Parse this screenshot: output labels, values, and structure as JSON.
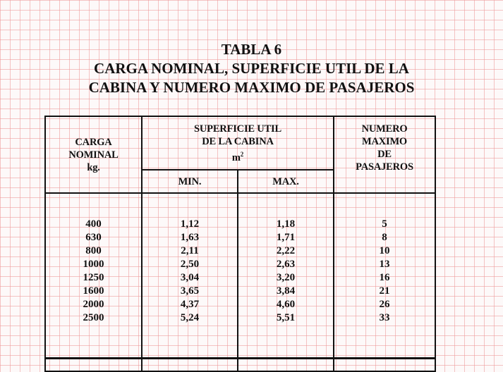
{
  "title": {
    "line1": "TABLA 6",
    "line2": "CARGA NOMINAL,  SUPERFICIE UTIL DE LA",
    "line3": "CABINA Y  NUMERO MAXIMO DE PASAJEROS"
  },
  "headers": {
    "carga_line1": "CARGA",
    "carga_line2": "NOMINAL",
    "carga_line3": "kg.",
    "superficie_line1": "SUPERFICIE UTIL",
    "superficie_line2": "DE LA CABINA",
    "superficie_unit": "m",
    "superficie_unit_exp": "2",
    "min": "MIN.",
    "max": "MAX.",
    "numero_line1": "NUMERO",
    "numero_line2": "MAXIMO",
    "numero_line3": "DE",
    "numero_line4": "PASAJEROS"
  },
  "rows": [
    {
      "carga": "400",
      "min": "1,12",
      "max": "1,18",
      "pasajeros": "5"
    },
    {
      "carga": "630",
      "min": "1,63",
      "max": "1,71",
      "pasajeros": "8"
    },
    {
      "carga": "800",
      "min": "2,11",
      "max": "2,22",
      "pasajeros": "10"
    },
    {
      "carga": "1000",
      "min": "2,50",
      "max": "2,63",
      "pasajeros": "13"
    },
    {
      "carga": "1250",
      "min": "3,04",
      "max": "3,20",
      "pasajeros": "16"
    },
    {
      "carga": "1600",
      "min": "3,65",
      "max": "3,84",
      "pasajeros": "21"
    },
    {
      "carga": "2000",
      "min": "4,37",
      "max": "4,60",
      "pasajeros": "26"
    },
    {
      "carga": "2500",
      "min": "5,24",
      "max": "5,51",
      "pasajeros": "33"
    }
  ]
}
